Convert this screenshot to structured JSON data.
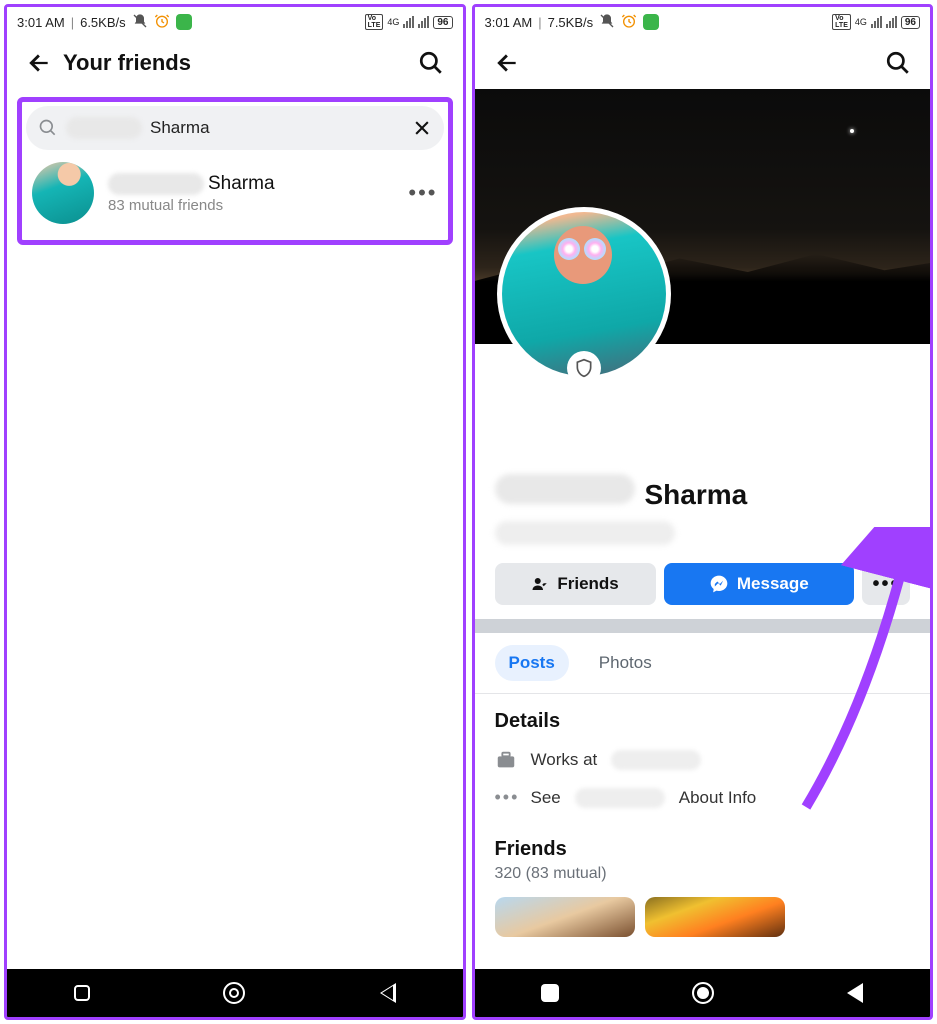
{
  "left": {
    "status": {
      "time": "3:01 AM",
      "speed": "6.5KB/s",
      "network": "4G",
      "battery": "96"
    },
    "header": {
      "title": "Your friends"
    },
    "search": {
      "value": "Sharma"
    },
    "result": {
      "name": "Sharma",
      "mutual": "83 mutual friends"
    }
  },
  "right": {
    "status": {
      "time": "3:01 AM",
      "speed": "7.5KB/s",
      "network": "4G",
      "battery": "96"
    },
    "profile": {
      "name": "Sharma",
      "friends_btn": "Friends",
      "message_btn": "Message"
    },
    "tabs": {
      "posts": "Posts",
      "photos": "Photos"
    },
    "details": {
      "title": "Details",
      "works_prefix": "Works at",
      "see_prefix": "See",
      "see_suffix": "About Info"
    },
    "friends_section": {
      "title": "Friends",
      "subtitle": "320 (83 mutual)"
    }
  }
}
